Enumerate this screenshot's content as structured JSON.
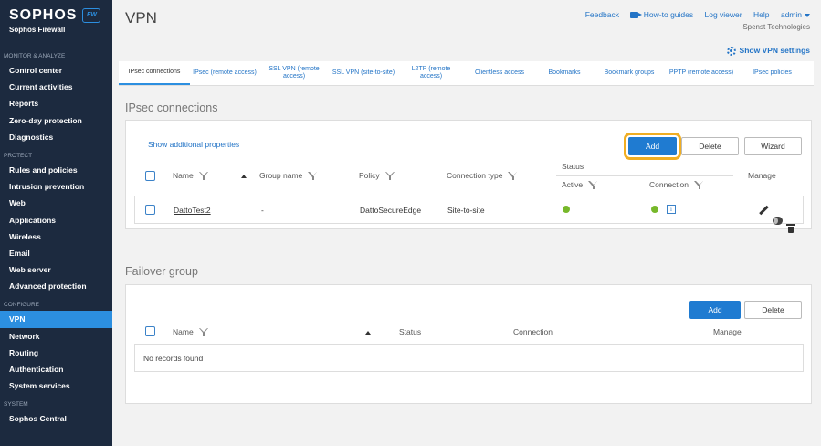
{
  "app": {
    "brand": "SOPHOS",
    "badge": "FW",
    "product": "Sophos Firewall"
  },
  "sidebar": {
    "sections": [
      {
        "label": "MONITOR & ANALYZE",
        "items": [
          "Control center",
          "Current activities",
          "Reports",
          "Zero-day protection",
          "Diagnostics"
        ]
      },
      {
        "label": "PROTECT",
        "items": [
          "Rules and policies",
          "Intrusion prevention",
          "Web",
          "Applications",
          "Wireless",
          "Email",
          "Web server",
          "Advanced protection"
        ]
      },
      {
        "label": "CONFIGURE",
        "items": [
          "VPN",
          "Network",
          "Routing",
          "Authentication",
          "System services"
        ]
      },
      {
        "label": "SYSTEM",
        "items": [
          "Sophos Central"
        ]
      }
    ],
    "active": "VPN"
  },
  "header": {
    "title": "VPN",
    "links": {
      "feedback": "Feedback",
      "howto": "How-to guides",
      "logviewer": "Log viewer",
      "help": "Help",
      "admin": "admin"
    },
    "company": "Spenst Technologies",
    "show_settings": "Show VPN settings"
  },
  "tabs": [
    {
      "label": "IPsec connections",
      "active": true
    },
    {
      "label": "IPsec (remote access)"
    },
    {
      "label": "SSL VPN (remote access)"
    },
    {
      "label": "SSL VPN (site-to-site)"
    },
    {
      "label": "L2TP (remote access)"
    },
    {
      "label": "Clientless access"
    },
    {
      "label": "Bookmarks"
    },
    {
      "label": "Bookmark groups"
    },
    {
      "label": "PPTP (remote access)"
    },
    {
      "label": "IPsec policies"
    }
  ],
  "ipsec": {
    "title": "IPsec connections",
    "show_props": "Show additional properties",
    "buttons": {
      "add": "Add",
      "delete": "Delete",
      "wizard": "Wizard"
    },
    "columns": {
      "name": "Name",
      "group": "Group name",
      "policy": "Policy",
      "conn_type": "Connection type",
      "status": "Status",
      "active": "Active",
      "connection": "Connection",
      "manage": "Manage"
    },
    "rows": [
      {
        "name": "DattoTest2",
        "group": "-",
        "policy": "DattoSecureEdge",
        "conn_type": "Site-to-site",
        "active": "green",
        "connection": "green"
      }
    ]
  },
  "failover": {
    "title": "Failover group",
    "buttons": {
      "add": "Add",
      "delete": "Delete"
    },
    "columns": {
      "name": "Name",
      "status": "Status",
      "connection": "Connection",
      "manage": "Manage"
    },
    "empty": "No records found"
  },
  "colors": {
    "sidebar_bg": "#1c2a3f",
    "accent": "#2c8fe0",
    "status_green": "#77b82a",
    "highlight": "#f0ae23"
  }
}
